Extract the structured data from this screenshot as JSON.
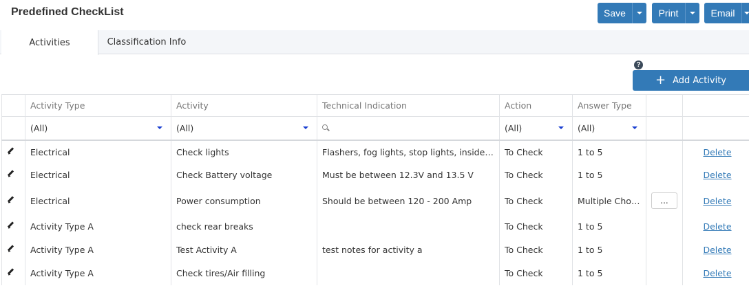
{
  "page": {
    "title": "Predefined CheckList"
  },
  "toolbar": {
    "save_label": "Save",
    "print_label": "Print",
    "email_label": "Email"
  },
  "tabs": [
    {
      "label": "Activities"
    },
    {
      "label": "Classification Info"
    }
  ],
  "actions": {
    "help_symbol": "?",
    "add_activity_label": "Add Activity"
  },
  "grid": {
    "columns": [
      "Activity Type",
      "Activity",
      "Technical Indication",
      "Action",
      "Answer Type"
    ],
    "filters": {
      "activity_type": "(All)",
      "activity": "(All)",
      "technical_indication": "",
      "action": "(All)",
      "answer_type": "(All)"
    },
    "more_label": "...",
    "delete_label": "Delete",
    "rows": [
      {
        "activity_type": "Electrical",
        "activity": "Check lights",
        "technical_indication": "Flashers, fog lights, stop lights, inside car..",
        "action": "To Check",
        "answer_type": "1 to 5"
      },
      {
        "activity_type": "Electrical",
        "activity": "Check Battery voltage",
        "technical_indication": "Must be between 12.3V and 13.5 V",
        "action": "To Check",
        "answer_type": "1 to 5"
      },
      {
        "activity_type": "Electrical",
        "activity": "Power consumption",
        "technical_indication": "Should be between 120 - 200 Amp",
        "action": "To Check",
        "answer_type": "Multiple Choice"
      },
      {
        "activity_type": "Activity Type A",
        "activity": "check rear breaks",
        "technical_indication": "",
        "action": "To Check",
        "answer_type": "1 to 5"
      },
      {
        "activity_type": "Activity Type A",
        "activity": "Test Activity A",
        "technical_indication": "test notes for activity a",
        "action": "To Check",
        "answer_type": "1 to 5"
      },
      {
        "activity_type": "Activity Type A",
        "activity": "Check tires/Air filling",
        "technical_indication": "",
        "action": "To Check",
        "answer_type": "1 to 5"
      }
    ]
  },
  "colors": {
    "primary": "#337ab7",
    "tabs_bg": "#f4f6f9",
    "link": "#337ab7"
  }
}
